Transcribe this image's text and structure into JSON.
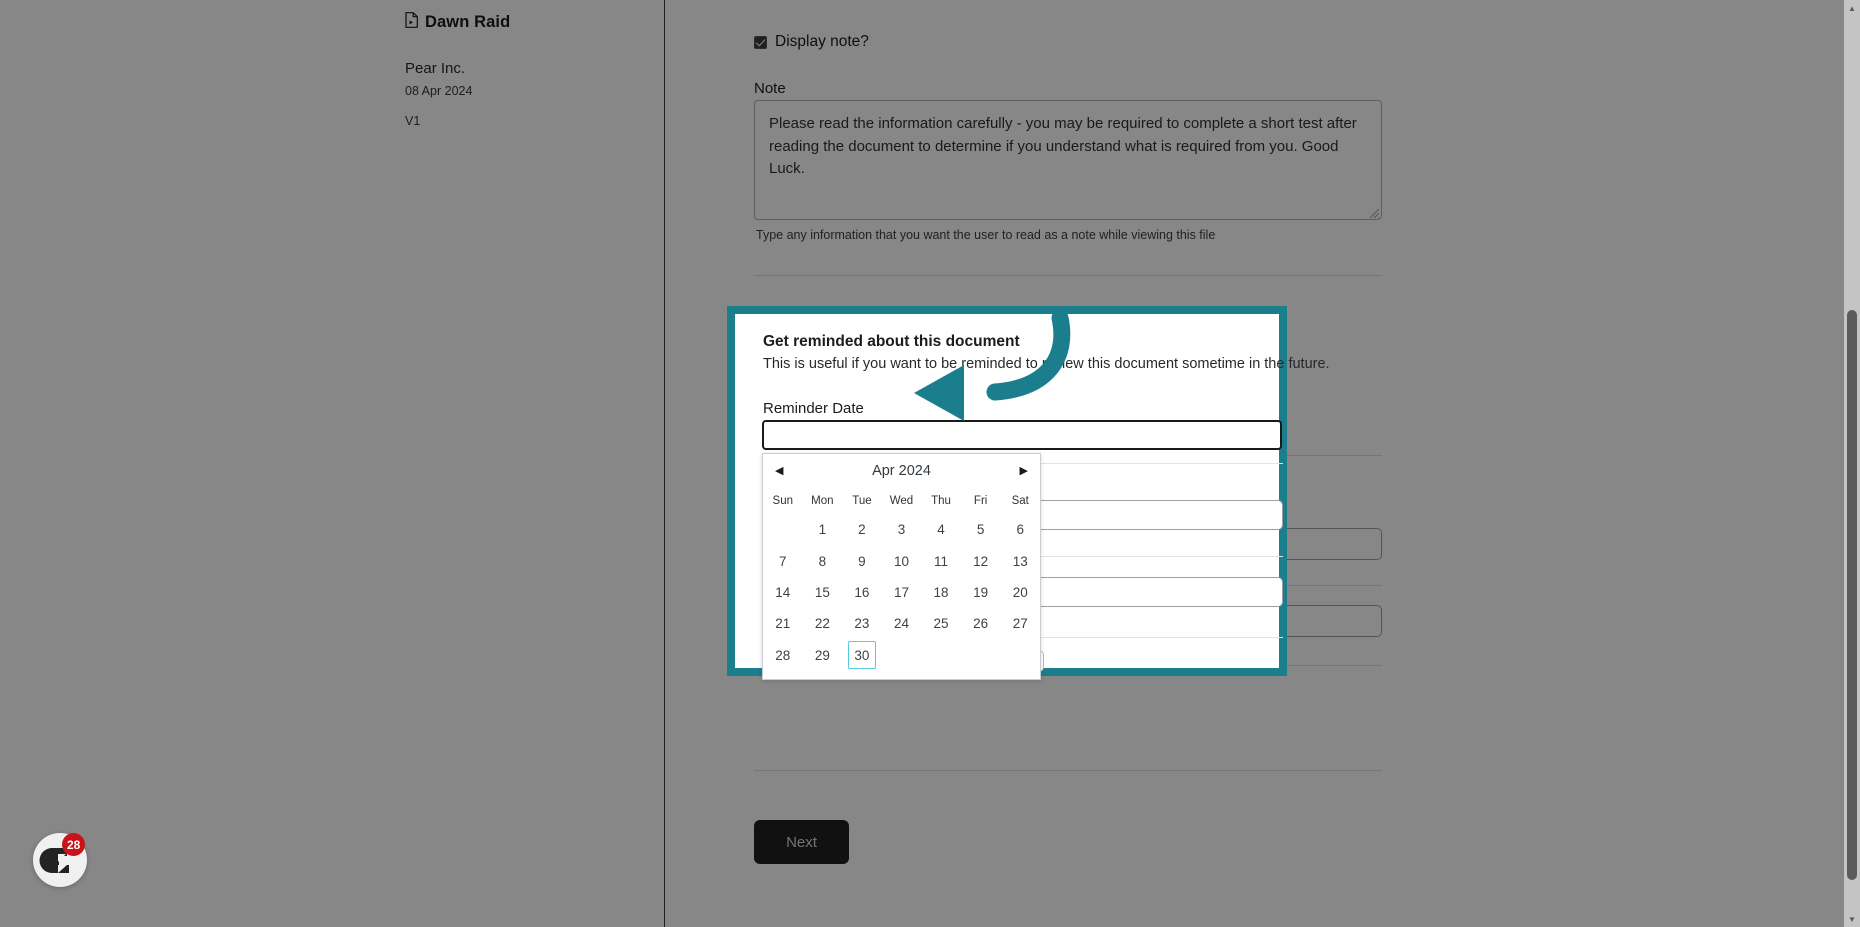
{
  "sidebar": {
    "document_title": "Dawn Raid",
    "document_icon": "file-video-icon",
    "organisation": "Pear Inc.",
    "date": "08 Apr 2024",
    "version": "V1"
  },
  "form": {
    "display_note_label": "Display note?",
    "display_note_checked": true,
    "note_label": "Note",
    "note_value": "Please read the information carefully - you may be required to complete a short test after reading the document to determine if you understand what is required from you. Good Luck.",
    "note_help": "Type any information that you want the user to read as a note while viewing this file",
    "next_label": "Next"
  },
  "reminder_panel": {
    "title": "Get reminded about this document",
    "subtitle": "This is useful if you want to be reminded to review this document sometime in the future.",
    "reminder_date_label": "Reminder Date",
    "reminder_date_value": "",
    "highlight_color": "#1b7e8c"
  },
  "datepicker": {
    "prev_icon": "◀",
    "next_icon": "▶",
    "month_year": "Apr 2024",
    "weekdays": [
      "Sun",
      "Mon",
      "Tue",
      "Wed",
      "Thu",
      "Fri",
      "Sat"
    ],
    "lead_blanks": 1,
    "days": [
      1,
      2,
      3,
      4,
      5,
      6,
      7,
      8,
      9,
      10,
      11,
      12,
      13,
      14,
      15,
      16,
      17,
      18,
      19,
      20,
      21,
      22,
      23,
      24,
      25,
      26,
      27,
      28,
      29,
      30
    ],
    "today": 30,
    "today_outline_color": "#5bc8e8"
  },
  "annotation": {
    "type": "curved-arrow",
    "color": "#1b7e8c",
    "points_to": "reminder-date-input"
  },
  "chat_widget": {
    "icon": "chat-logo-icon",
    "badge_count": "28",
    "badge_color": "#c9131a"
  },
  "scrollbar": {
    "up_icon": "▲",
    "down_icon": "▼"
  }
}
